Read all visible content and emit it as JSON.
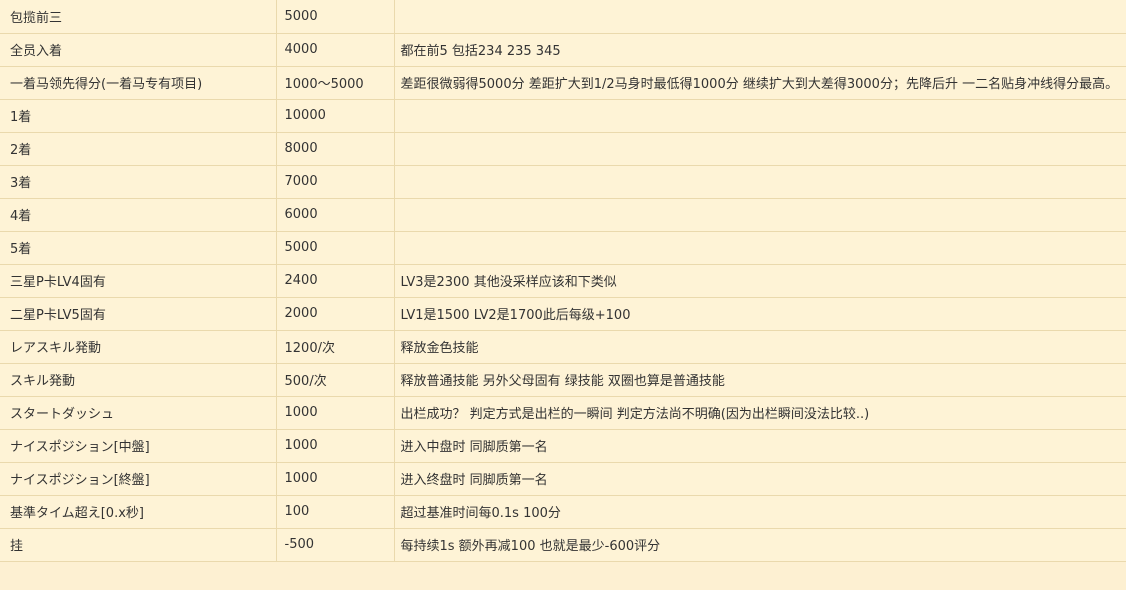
{
  "rows": [
    {
      "item": "包揽前三",
      "score": "5000",
      "note": ""
    },
    {
      "item": "全员入着",
      "score": "4000",
      "note": "都在前5 包括234 235 345"
    },
    {
      "item": "一着马领先得分(一着马专有项目)",
      "score": "1000～5000",
      "note": "差距很微弱得5000分 差距扩大到1/2马身时最低得1000分 继续扩大到大差得3000分；先降后升 一二名贴身冲线得分最高。"
    },
    {
      "item": "1着",
      "score": "10000",
      "note": ""
    },
    {
      "item": "2着",
      "score": "8000",
      "note": ""
    },
    {
      "item": "3着",
      "score": "7000",
      "note": ""
    },
    {
      "item": "4着",
      "score": "6000",
      "note": ""
    },
    {
      "item": "5着",
      "score": "5000",
      "note": ""
    },
    {
      "item": "三星P卡LV4固有",
      "score": "2400",
      "note": "LV3是2300 其他没采样应该和下类似"
    },
    {
      "item": "二星P卡LV5固有",
      "score": "2000",
      "note": "LV1是1500 LV2是1700此后每级+100"
    },
    {
      "item": "レアスキル発動",
      "score": "1200/次",
      "note": "释放金色技能"
    },
    {
      "item": "スキル発動",
      "score": "500/次",
      "note": "释放普通技能 另外父母固有 绿技能 双圈也算是普通技能"
    },
    {
      "item": "スタートダッシュ",
      "score": "1000",
      "note": "出栏成功？ 判定方式是出栏的一瞬间 判定方法尚不明确(因为出栏瞬间没法比较..)"
    },
    {
      "item": "ナイスポジション[中盤]",
      "score": "1000",
      "note": "进入中盘时 同脚质第一名"
    },
    {
      "item": "ナイスポジション[終盤]",
      "score": "1000",
      "note": "进入终盘时 同脚质第一名"
    },
    {
      "item": "基準タイム超え[0.x秒]",
      "score": "100",
      "note": "超过基准时间每0.1s 100分"
    },
    {
      "item": "挂",
      "score": "-500",
      "note": "每持续1s 额外再减100 也就是最少-600评分"
    }
  ]
}
